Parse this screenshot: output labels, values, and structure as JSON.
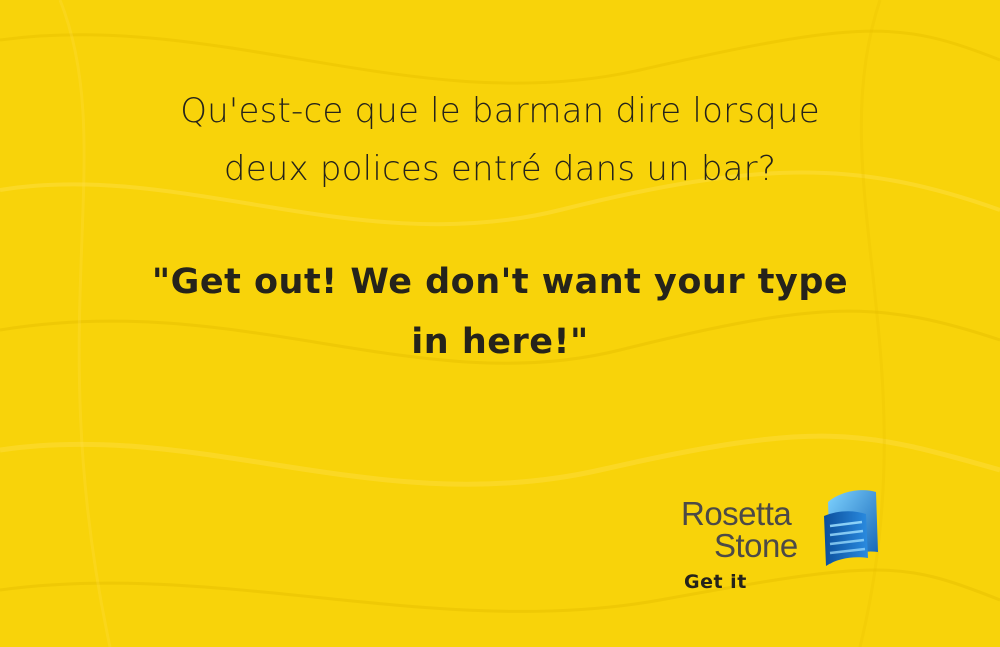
{
  "joke": {
    "question_lines": [
      "Qu'est-ce que le barman dire lorsque",
      "deux polices entré dans un bar?"
    ],
    "punchline_lines": [
      "\"Get out! We don't want your type",
      "in here!\""
    ]
  },
  "brand": {
    "name_line_1": "Rosetta",
    "name_line_2": "Stone",
    "logo_icon": "rosetta-stone-logo-icon",
    "cta_label": "Get it"
  },
  "colors": {
    "background": "#f8d30a",
    "text": "#25231b",
    "brand_text": "#4c4a47",
    "logo_blue": "#1a73c9"
  }
}
